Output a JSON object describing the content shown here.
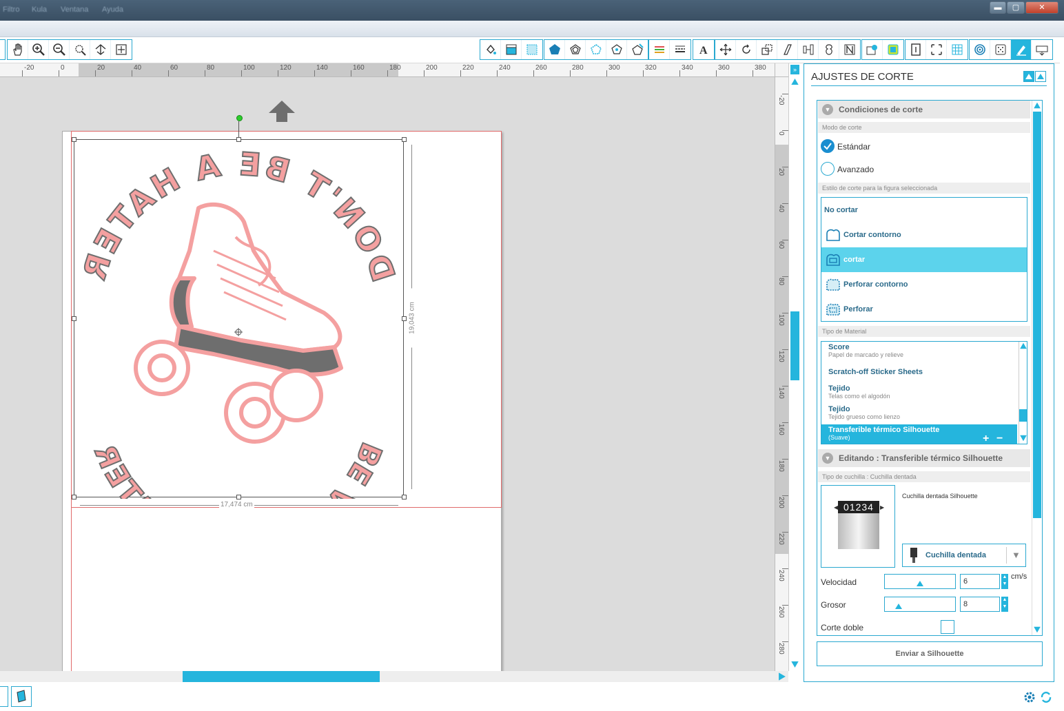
{
  "menu": [
    "Filtro",
    "Kula",
    "Ventana",
    "Ayuda"
  ],
  "window_buttons": {
    "minimize": "▬",
    "maximize": "▢",
    "close": "✕"
  },
  "ruler": {
    "h_ticks": [
      "-20",
      "0",
      "20",
      "40",
      "60",
      "80",
      "100",
      "120",
      "140",
      "160",
      "180",
      "200",
      "220",
      "240",
      "260",
      "280",
      "300",
      "320",
      "340",
      "360",
      "380"
    ],
    "v_ticks": [
      "-20",
      "0",
      "20",
      "40",
      "60",
      "80",
      "100",
      "120",
      "140",
      "160",
      "180",
      "200",
      "220",
      "240",
      "260",
      "280"
    ]
  },
  "canvas": {
    "width_label": "17,474 cm",
    "height_label": "19,043 cm",
    "design_top_text": "DON'T BE A HATER",
    "design_bottom_text": "BE A ROLLER SKATER"
  },
  "panel": {
    "title": "AJUSTES DE CORTE",
    "conditions_header": "Condiciones de corte",
    "mode_label": "Modo de corte",
    "mode_standard": "Estándar",
    "mode_advanced": "Avanzado",
    "style_label": "Estilo de corte para la figura seleccionada",
    "cut_styles": [
      "No cortar",
      "Cortar contorno",
      "cortar",
      "Perforar contorno",
      "Perforar"
    ],
    "selected_cut_style": "cortar",
    "material_label": "Tipo de Material",
    "materials": [
      {
        "name": "Score",
        "desc": "Papel de marcado y relieve"
      },
      {
        "name": "Scratch-off Sticker Sheets",
        "desc": ""
      },
      {
        "name": "Tejido",
        "desc": "Telas como el algodón"
      },
      {
        "name": "Tejido",
        "desc": "Tejido grueso como lienzo"
      },
      {
        "name": "Transferible térmico Silhouette",
        "desc": "(Suave)"
      }
    ],
    "add_symbol": "+",
    "remove_symbol": "−",
    "editing_header": "Editando : Transferible térmico Silhouette",
    "blade_type_label": "Tipo de cuchilla : Cuchilla dentada",
    "blade_name": "Cuchilla dentada Silhouette",
    "blade_digits": "01234",
    "blade_select": "Cuchilla dentada",
    "speed_label": "Velocidad",
    "speed_value": "6",
    "speed_unit": "cm/s",
    "speed_fraction": 0.5,
    "thickness_label": "Grosor",
    "thickness_value": "8",
    "thickness_fraction": 0.2,
    "double_cut_label": "Corte doble",
    "send_button": "Enviar a Silhouette"
  },
  "colors": {
    "accent": "#25b5dd",
    "design_pink": "#f4a0a0",
    "design_gray": "#6e6e6e",
    "cutline": "#e06a6a"
  }
}
